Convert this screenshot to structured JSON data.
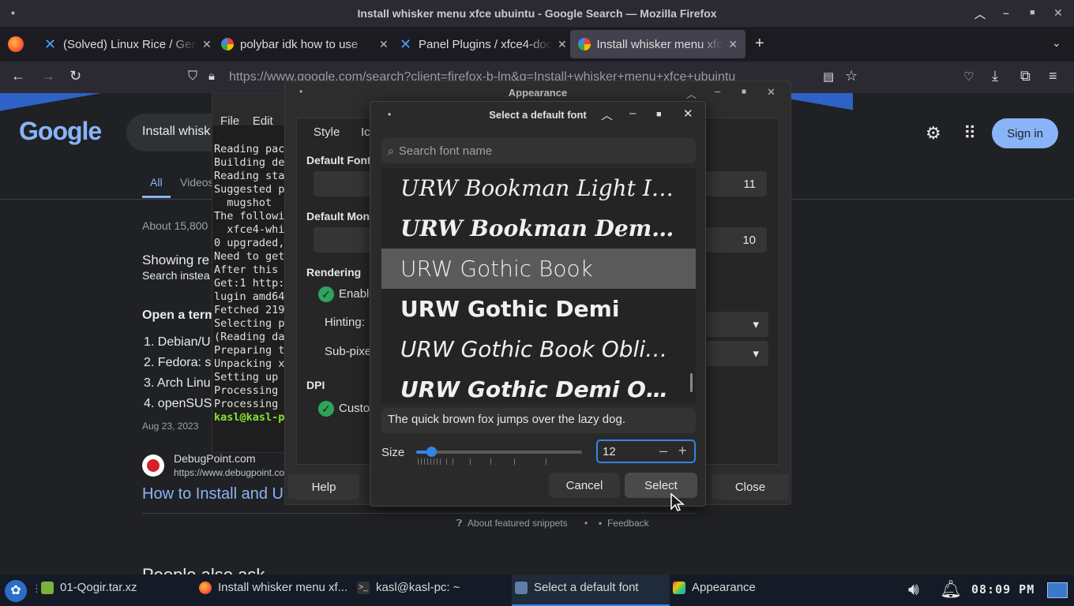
{
  "firefox": {
    "title": "Install whisker menu xfce ubuintu - Google Search — Mozilla Firefox",
    "tabs": [
      {
        "label": "(Solved) Linux Rice / Gen"
      },
      {
        "label": "polybar idk how to use"
      },
      {
        "label": "Panel Plugins / xfce4-doc"
      },
      {
        "label": "Install whisker menu xfce"
      }
    ],
    "url": "https://www.google.com/search?client=firefox-b-lm&q=Install+whisker+menu+xfce+ubuintu"
  },
  "google": {
    "logo": "Google",
    "search_value": "Install whisk",
    "tabs": [
      "All",
      "Videos"
    ],
    "result_count": "About 15,800",
    "showing": "Showing re",
    "search_instead": "Search instea",
    "snippet_heading": "Open a term",
    "steps": [
      "1. Debian/U",
      "2. Fedora: s",
      "3. Arch Linu",
      "4. openSUS"
    ],
    "date": "Aug 23, 2023",
    "source_name": "DebugPoint.com",
    "source_url": "https://www.debugpoint.com",
    "result_link": "How to Install and U",
    "about_snippets": "About featured snippets",
    "feedback": "Feedback",
    "signin": "Sign in",
    "bottom_heading": "People also ask"
  },
  "terminal": {
    "menu_file": "File",
    "menu_edit": "Edit",
    "lines": [
      "Reading pac",
      "Building de",
      "Reading sta",
      "Suggested p",
      "  mugshot",
      "The followi",
      "  xfce4-whi",
      "0 upgraded,",
      "Need to get",
      "After this",
      "Get:1 http:",
      "lugin amd64",
      "Fetched 219",
      "Selecting p",
      "(Reading da",
      "Preparing t",
      "Unpacking x",
      "Setting up",
      "Processing",
      "Processing"
    ],
    "prompt": "kasl@kasl-p"
  },
  "appearance": {
    "title": "Appearance",
    "tab_style": "Style",
    "tab_icons": "Ic",
    "default_font": "Default Font",
    "default_font_size": "11",
    "default_mono": "Default Mon",
    "default_mono_size": "10",
    "rendering": "Rendering",
    "enable": "Enabl",
    "hinting": "Hinting:",
    "subpixel": "Sub-pixe",
    "dpi": "DPI",
    "custom": "Custo",
    "help": "Help",
    "close": "Close"
  },
  "font_dialog": {
    "title": "Select a default font",
    "search_placeholder": "Search font name",
    "fonts": [
      {
        "name": "URW Bookman Light Italic"
      },
      {
        "name": "URW Bookman Demi Italic"
      },
      {
        "name": "URW Gothic Book"
      },
      {
        "name": "URW Gothic Demi"
      },
      {
        "name": "URW Gothic Book Oblique"
      },
      {
        "name": "URW Gothic Demi Oblique"
      }
    ],
    "selected_index": 2,
    "preview_text": "The quick brown fox jumps over the lazy dog.",
    "size_label": "Size",
    "size_value": "12",
    "cancel": "Cancel",
    "select": "Select"
  },
  "taskbar": {
    "items": [
      {
        "label": "01-Qogir.tar.xz"
      },
      {
        "label": "Install whisker menu xf..."
      },
      {
        "label": "kasl@kasl-pc: ~"
      },
      {
        "label": "Select a default font"
      },
      {
        "label": "Appearance"
      }
    ],
    "clock": "08:09 PM"
  },
  "colors": {
    "accent": "#3584e4",
    "google_link": "#8ab4f8",
    "check_green": "#2fa35a",
    "terminal_prompt": "#8ae234"
  }
}
